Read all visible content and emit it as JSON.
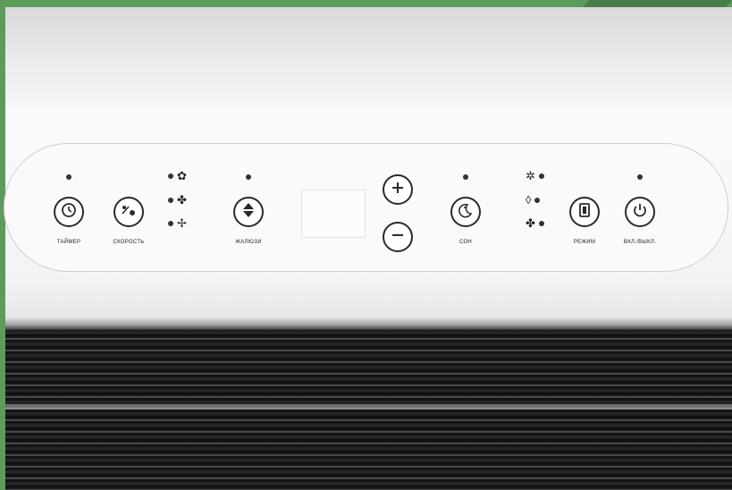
{
  "control_panel": {
    "buttons": {
      "timer": {
        "label": "ТАЙМЕР",
        "icon": "clock-icon"
      },
      "speed": {
        "label": "СКОРОСТЬ",
        "icon": "fan-speed-icon"
      },
      "louvers": {
        "label": "ЖАЛЮЗИ",
        "icon": "up-down-arrow-icon"
      },
      "sleep": {
        "label": "СОН",
        "icon": "moon-icon"
      },
      "mode": {
        "label": "РЕЖИМ",
        "icon": "mode-icon"
      },
      "power": {
        "label": "ВКЛ./ВЫКЛ.",
        "icon": "power-icon"
      }
    },
    "speed_indicators": [
      "fan-high-icon",
      "fan-medium-icon",
      "fan-low-icon"
    ],
    "mode_indicators": [
      "cool-icon",
      "dry-icon",
      "fan-icon"
    ],
    "temperature": {
      "plus_icon": "plus-icon",
      "minus_icon": "minus-icon"
    },
    "colors": {
      "background": "#5c9c5a",
      "panel": "#fafafa",
      "button_border": "#2a2a2a"
    }
  }
}
